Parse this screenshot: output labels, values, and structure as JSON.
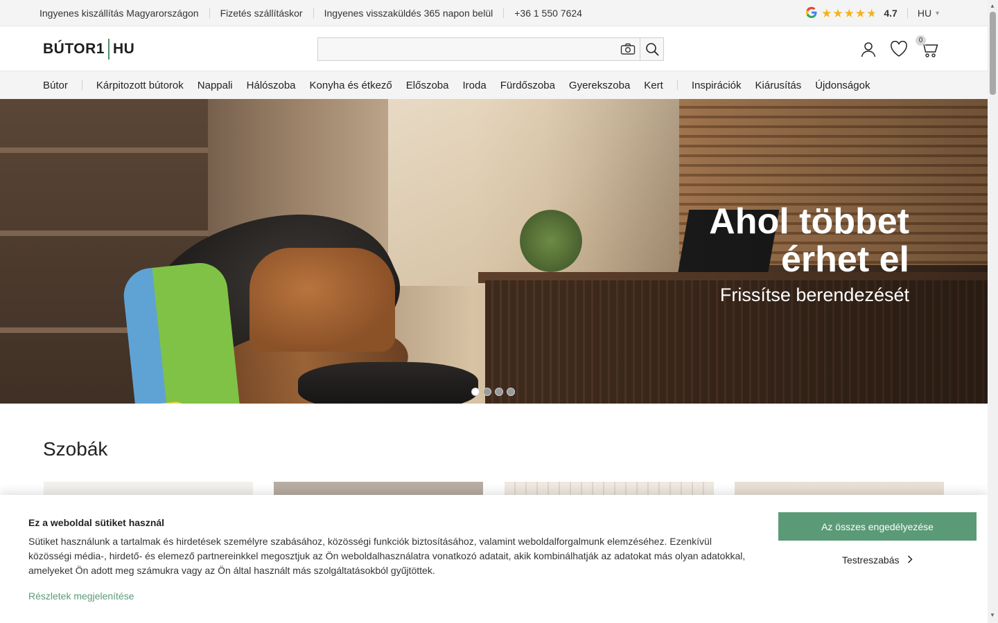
{
  "topbar": {
    "info": [
      "Ingyenes kiszállítás Magyarországon",
      "Fizetés szállításkor",
      "Ingyenes visszaküldés 365 napon belül",
      "+36 1 550 7624"
    ],
    "google_icon": "google-icon",
    "rating": "4.7",
    "rating_stars": 4.7,
    "language": "HU"
  },
  "header": {
    "logo_left": "BÚTOR1",
    "logo_right": "HU",
    "search_placeholder": "",
    "cart_count": "0"
  },
  "nav": {
    "items": [
      "Bútor",
      "Kárpitozott bútorok",
      "Nappali",
      "Hálószoba",
      "Konyha és étkező",
      "Előszoba",
      "Iroda",
      "Fürdőszoba",
      "Gyerekszoba",
      "Kert",
      "Inspirációk",
      "Kiárusítás",
      "Újdonságok"
    ]
  },
  "hero": {
    "title": "Ahol többet érhet el",
    "subtitle": "Frissítse berendezését",
    "slides": 4,
    "active_slide": 1
  },
  "rooms": {
    "title": "Szobák"
  },
  "cookie": {
    "title": "Ez a weboldal sütiket használ",
    "text": "Sütiket használunk a tartalmak és hirdetések személyre szabásához, közösségi funkciók biztosításához, valamint weboldalforgalmunk elemzéséhez. Ezenkívül közösségi média-, hirdető- és elemező partnereinkkel megosztjuk az Ön weboldalhasználatra vonatkozó adatait, akik kombinálhatják az adatokat más olyan adatokkal, amelyeket Ön adott meg számukra vagy az Ön által használt más szolgáltatásokból gyűjtöttek.",
    "details_link": "Részletek megjelenítése",
    "accept_all": "Az összes engedélyezése",
    "customize": "Testreszabás"
  },
  "colors": {
    "accent": "#5b9a76",
    "star": "#f6b21b",
    "topbar_bg": "#f4f4f4"
  }
}
